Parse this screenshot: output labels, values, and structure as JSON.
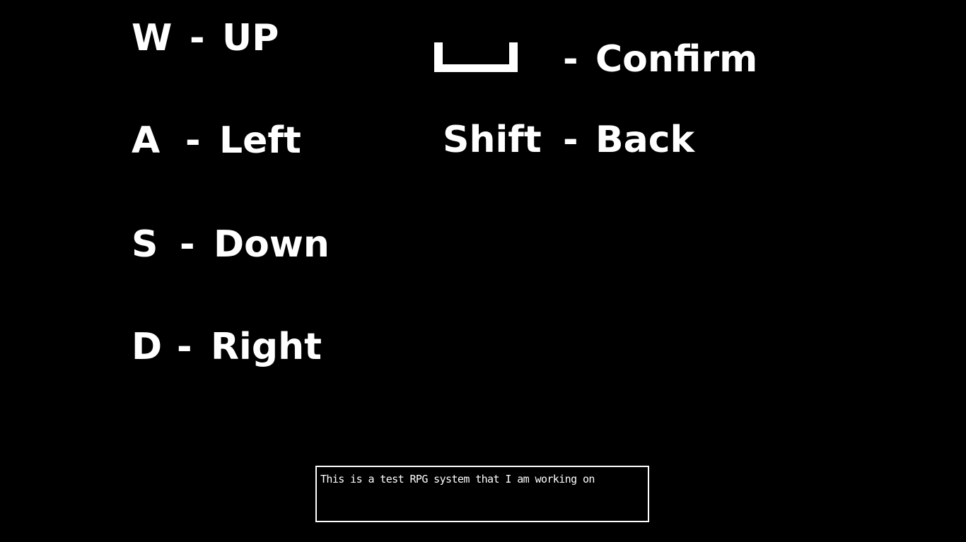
{
  "controls": {
    "left": [
      {
        "key": "W",
        "separator": "-",
        "action": "UP"
      },
      {
        "key": "A",
        "separator": "-",
        "action": "Left"
      },
      {
        "key": "S",
        "separator": "-",
        "action": "Down"
      },
      {
        "key": "D",
        "separator": "-",
        "action": "Right"
      }
    ],
    "right": [
      {
        "key_icon": "spacebar-icon",
        "separator": "-",
        "action": "Confirm"
      },
      {
        "key": "Shift",
        "separator": "-",
        "action": "Back"
      }
    ]
  },
  "message_box": {
    "text": "This is a test RPG system that I am working on"
  },
  "colors": {
    "background": "#000000",
    "text": "#ffffff"
  }
}
